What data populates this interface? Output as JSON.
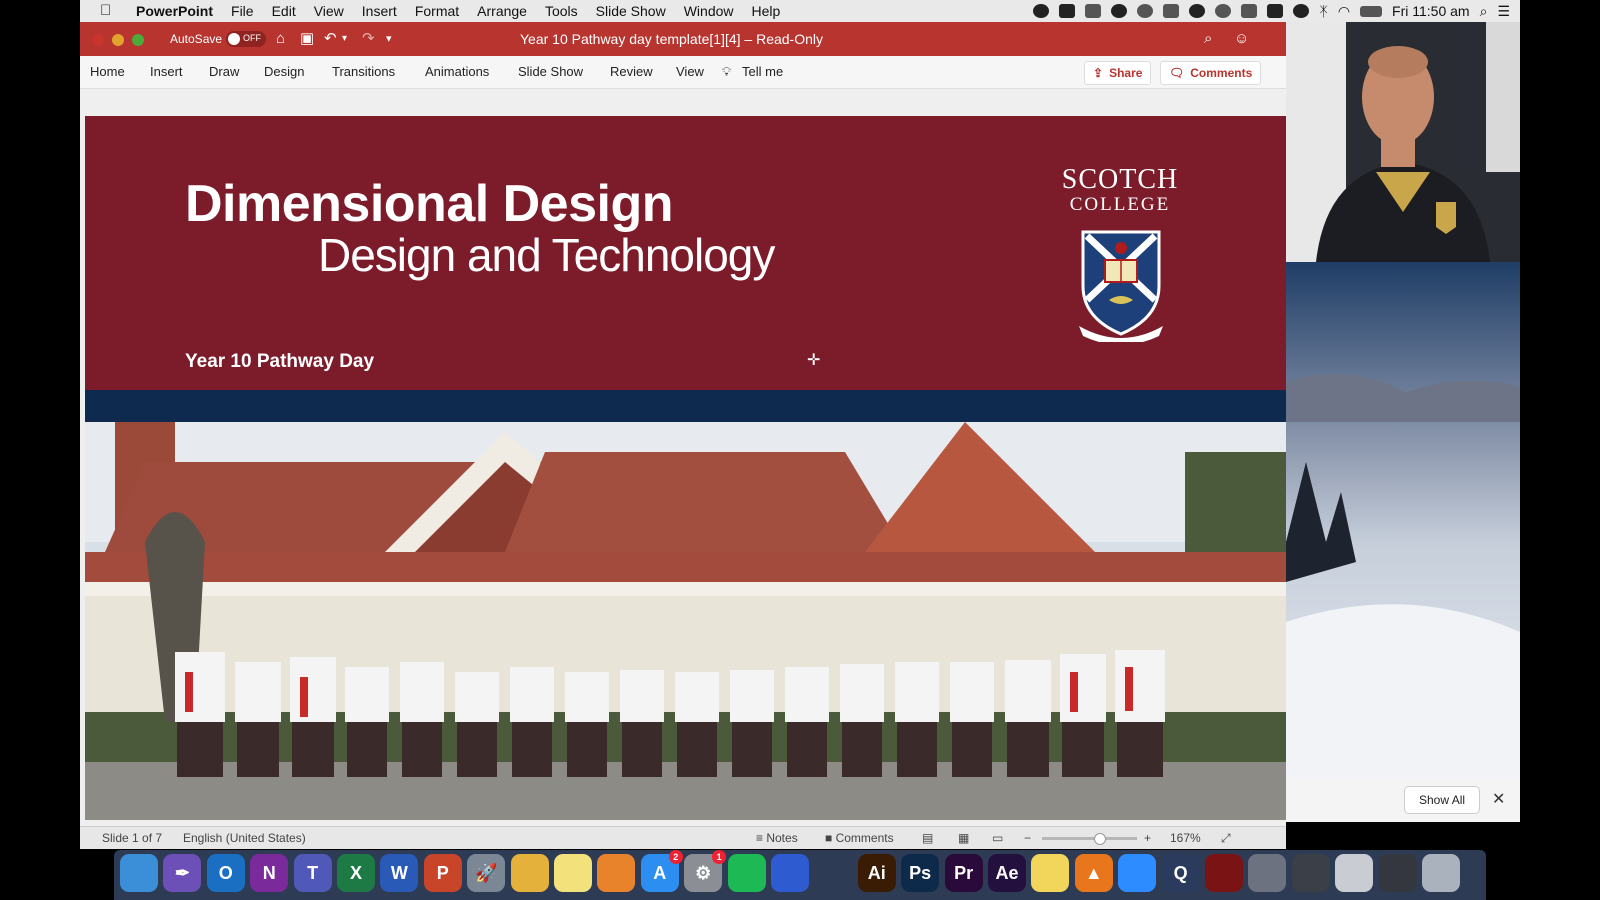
{
  "menubar": {
    "app_name": "PowerPoint",
    "items": [
      "File",
      "Edit",
      "View",
      "Insert",
      "Format",
      "Arrange",
      "Tools",
      "Slide Show",
      "Window",
      "Help"
    ],
    "clock": "Fri 11:50 am"
  },
  "window": {
    "autosave_label": "AutoSave",
    "autosave_state": "OFF",
    "title": "Year 10 Pathway day template[1][4]  –  Read-Only",
    "accent_color": "#b7342f"
  },
  "ribbon": {
    "tabs": [
      "Home",
      "Insert",
      "Draw",
      "Design",
      "Transitions",
      "Animations",
      "Slide Show",
      "Review",
      "View"
    ],
    "tell_me": "Tell me",
    "share": "Share",
    "comments": "Comments"
  },
  "slide": {
    "title": "Dimensional Design",
    "subtitle_line": "Design and Technology",
    "event": "Year 10 Pathway Day",
    "logo_line1": "SCOTCH",
    "logo_line2": "COLLEGE",
    "background_color": "#7c1c2a",
    "band_color": "#0e2a4f"
  },
  "status": {
    "slide_indicator": "Slide 1 of 7",
    "language": "English (United States)",
    "notes": "Notes",
    "comments": "Comments",
    "zoom": "167%",
    "zoom_level_fraction": 0.6
  },
  "side_panel": {
    "show_all": "Show All",
    "close": "✕"
  },
  "dock": {
    "apps": [
      {
        "name": "finder-icon",
        "label": "",
        "color": "#3b8fd9"
      },
      {
        "name": "quill-icon",
        "label": "✒",
        "color": "#6d4fb8"
      },
      {
        "name": "outlook-icon",
        "label": "O",
        "color": "#1a6fc2"
      },
      {
        "name": "onenote-icon",
        "label": "N",
        "color": "#7a2a9b"
      },
      {
        "name": "teams-icon",
        "label": "T",
        "color": "#5058b8"
      },
      {
        "name": "excel-icon",
        "label": "X",
        "color": "#1d7a45"
      },
      {
        "name": "word-icon",
        "label": "W",
        "color": "#2a5ab8"
      },
      {
        "name": "powerpoint-icon",
        "label": "P",
        "color": "#c9452a"
      },
      {
        "name": "launchpad-icon",
        "label": "🚀",
        "color": "#7c8796"
      },
      {
        "name": "chrome-icon",
        "label": "",
        "color": "#e4b23a"
      },
      {
        "name": "notes-icon",
        "label": "",
        "color": "#f3e27b"
      },
      {
        "name": "books-icon",
        "label": "",
        "color": "#e8832c"
      },
      {
        "name": "appstore-icon",
        "label": "A",
        "color": "#2b8ef0",
        "badge": "2"
      },
      {
        "name": "system-preferences-icon",
        "label": "⚙",
        "color": "#8b8f95",
        "badge": "1"
      },
      {
        "name": "spotify-icon",
        "label": "",
        "color": "#1db954"
      },
      {
        "name": "photo-app-icon",
        "label": "",
        "color": "#2f5bd1"
      },
      {
        "name": "swift-bird-icon",
        "label": "",
        "color": "#2e3b55"
      },
      {
        "name": "illustrator-icon",
        "label": "Ai",
        "color": "#3a1c05"
      },
      {
        "name": "photoshop-icon",
        "label": "Ps",
        "color": "#0d2a4a"
      },
      {
        "name": "premiere-icon",
        "label": "Pr",
        "color": "#2a0a3a"
      },
      {
        "name": "after-effects-icon",
        "label": "Ae",
        "color": "#24103f"
      },
      {
        "name": "stickies-icon",
        "label": "",
        "color": "#f2d55b"
      },
      {
        "name": "vlc-icon",
        "label": "▲",
        "color": "#e8761c"
      },
      {
        "name": "zoom-icon",
        "label": "",
        "color": "#2d8cff"
      },
      {
        "name": "quicktime-icon",
        "label": "Q",
        "color": "#2a3b5e"
      },
      {
        "name": "terminal-red-icon",
        "label": "",
        "color": "#7a1414"
      },
      {
        "name": "window-thumb-1-icon",
        "label": "",
        "color": "#6c7280"
      },
      {
        "name": "window-thumb-2-icon",
        "label": "",
        "color": "#3a3f48"
      },
      {
        "name": "window-thumb-3-icon",
        "label": "",
        "color": "#c9ccd3"
      },
      {
        "name": "window-thumb-4-icon",
        "label": "",
        "color": "#34373d"
      },
      {
        "name": "trash-icon",
        "label": "",
        "color": "#aab2bd"
      }
    ]
  }
}
